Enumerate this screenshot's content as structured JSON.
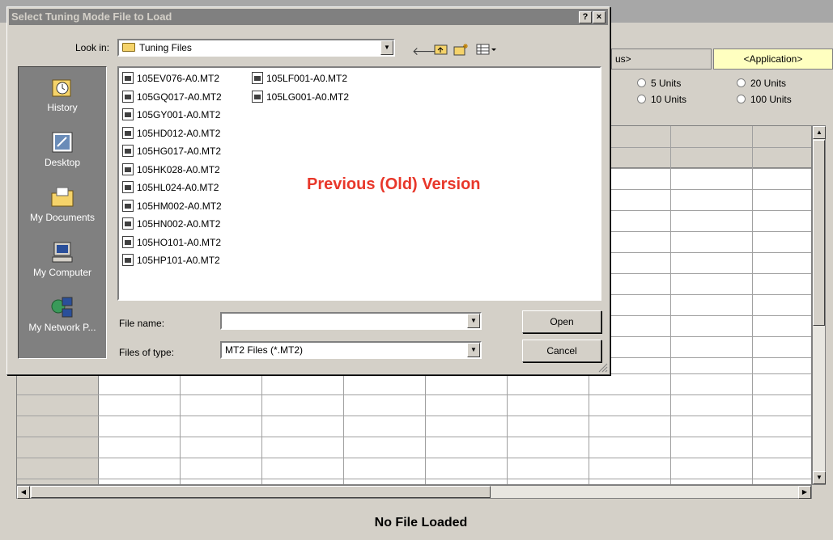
{
  "background": {
    "tabs": {
      "partial": "us>",
      "application": "<Application>"
    },
    "radios": [
      {
        "label": "5 Units"
      },
      {
        "label": "10 Units"
      },
      {
        "label": "20 Units"
      },
      {
        "label": "100 Units"
      }
    ],
    "status": "No File Loaded"
  },
  "dialog": {
    "title": "Select Tuning Mode File to Load",
    "help_label": "?",
    "close_label": "×",
    "look_in_label": "Look in:",
    "look_in_value": "Tuning Files",
    "places": [
      {
        "label": "History",
        "icon": "history-icon"
      },
      {
        "label": "Desktop",
        "icon": "desktop-icon"
      },
      {
        "label": "My Documents",
        "icon": "my-documents-icon"
      },
      {
        "label": "My Computer",
        "icon": "my-computer-icon"
      },
      {
        "label": "My Network P...",
        "icon": "network-icon"
      }
    ],
    "files_col1": [
      "105EV076-A0.MT2",
      "105GQ017-A0.MT2",
      "105GY001-A0.MT2",
      "105HD012-A0.MT2",
      "105HG017-A0.MT2",
      "105HK028-A0.MT2",
      "105HL024-A0.MT2",
      "105HM002-A0.MT2",
      "105HN002-A0.MT2",
      "105HO101-A0.MT2",
      "105HP101-A0.MT2"
    ],
    "files_col2": [
      "105LF001-A0.MT2",
      "105LG001-A0.MT2"
    ],
    "overlay_text": "Previous (Old) Version",
    "file_name_label": "File name:",
    "file_name_value": "",
    "files_of_type_label": "Files of type:",
    "files_of_type_value": "MT2 Files (*.MT2)",
    "open_label": "Open",
    "cancel_label": "Cancel"
  }
}
